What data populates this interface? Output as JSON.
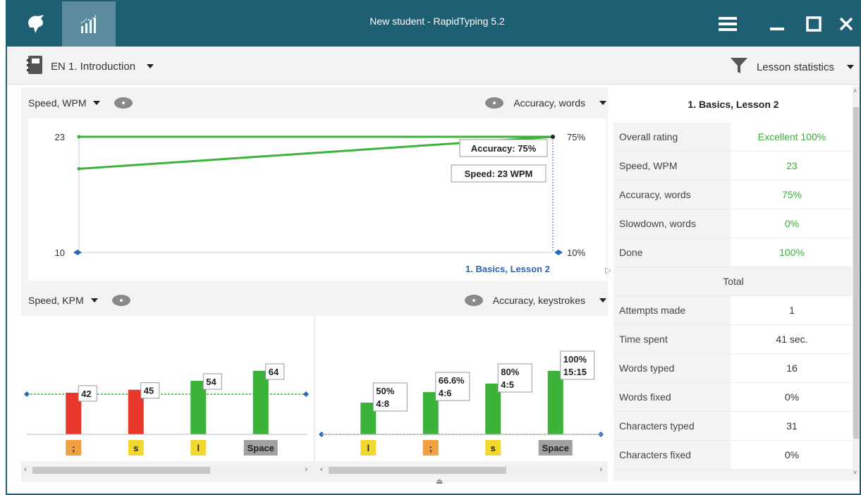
{
  "window": {
    "title": "New student - RapidTyping 5.2"
  },
  "toolbar": {
    "lesson": "EN 1. Introduction",
    "stats_view": "Lesson statistics"
  },
  "top_chart": {
    "left_metric": "Speed, WPM",
    "right_metric": "Accuracy, words",
    "y_left_ticks": [
      "23",
      "10"
    ],
    "y_right_ticks": [
      "75%",
      "10%"
    ],
    "label_accuracy": "Accuracy: 75%",
    "label_speed": "Speed: 23 WPM",
    "x_label": "1. Basics, Lesson 2"
  },
  "bottom_header": {
    "left_metric": "Speed, KPM",
    "right_metric": "Accuracy, keystrokes"
  },
  "chart_data": [
    {
      "type": "line",
      "x": [
        "",
        "1. Basics, Lesson 2"
      ],
      "series": [
        {
          "values": [
            23,
            23
          ]
        },
        {
          "values": [
            57,
            75
          ]
        }
      ]
    },
    {
      "type": "bar",
      "categories": [
        ";",
        "s",
        "l",
        "Space"
      ],
      "values": [
        42,
        45,
        54,
        64
      ],
      "value_labels": [
        "42",
        "45",
        "54",
        "64"
      ],
      "bar_colors": [
        "#e8382b",
        "#e8382b",
        "#3bb33b",
        "#3bb33b"
      ],
      "key_colors": [
        "#f0a040",
        "#f2d72e",
        "#f2d72e",
        "#a0a0a0"
      ]
    },
    {
      "type": "bar",
      "categories": [
        "l",
        ";",
        "s",
        "Space"
      ],
      "values": [
        50,
        66.6,
        80,
        100
      ],
      "value_labels": [
        [
          "50%",
          "4:8"
        ],
        [
          "66.6%",
          "4:6"
        ],
        [
          "80%",
          "4:5"
        ],
        [
          "100%",
          "15:15"
        ]
      ],
      "bar_colors": [
        "#3bb33b",
        "#3bb33b",
        "#3bb33b",
        "#3bb33b"
      ],
      "key_colors": [
        "#f2d72e",
        "#f0a040",
        "#f2d72e",
        "#a0a0a0"
      ]
    }
  ],
  "sidebar": {
    "header": "1. Basics, Lesson 2",
    "rows": [
      {
        "label": "Overall rating",
        "value": "Excellent 100%"
      },
      {
        "label": "Speed, WPM",
        "value": "23"
      },
      {
        "label": "Accuracy, words",
        "value": "75%"
      },
      {
        "label": "Slowdown, words",
        "value": "0%"
      },
      {
        "label": "Done",
        "value": "100%"
      }
    ],
    "total_header": "Total",
    "total_rows": [
      {
        "label": "Attempts made",
        "value": "1"
      },
      {
        "label": "Time spent",
        "value": "41 sec."
      },
      {
        "label": "Words typed",
        "value": "16"
      },
      {
        "label": "Words fixed",
        "value": "0%"
      },
      {
        "label": "Characters typed",
        "value": "31"
      },
      {
        "label": "Characters fixed",
        "value": "0%"
      }
    ]
  },
  "colors": {
    "titlebar": "#1e5f74",
    "accent_green": "#3bb33b",
    "bar_red": "#e8382b",
    "link_blue": "#2a66b8"
  }
}
